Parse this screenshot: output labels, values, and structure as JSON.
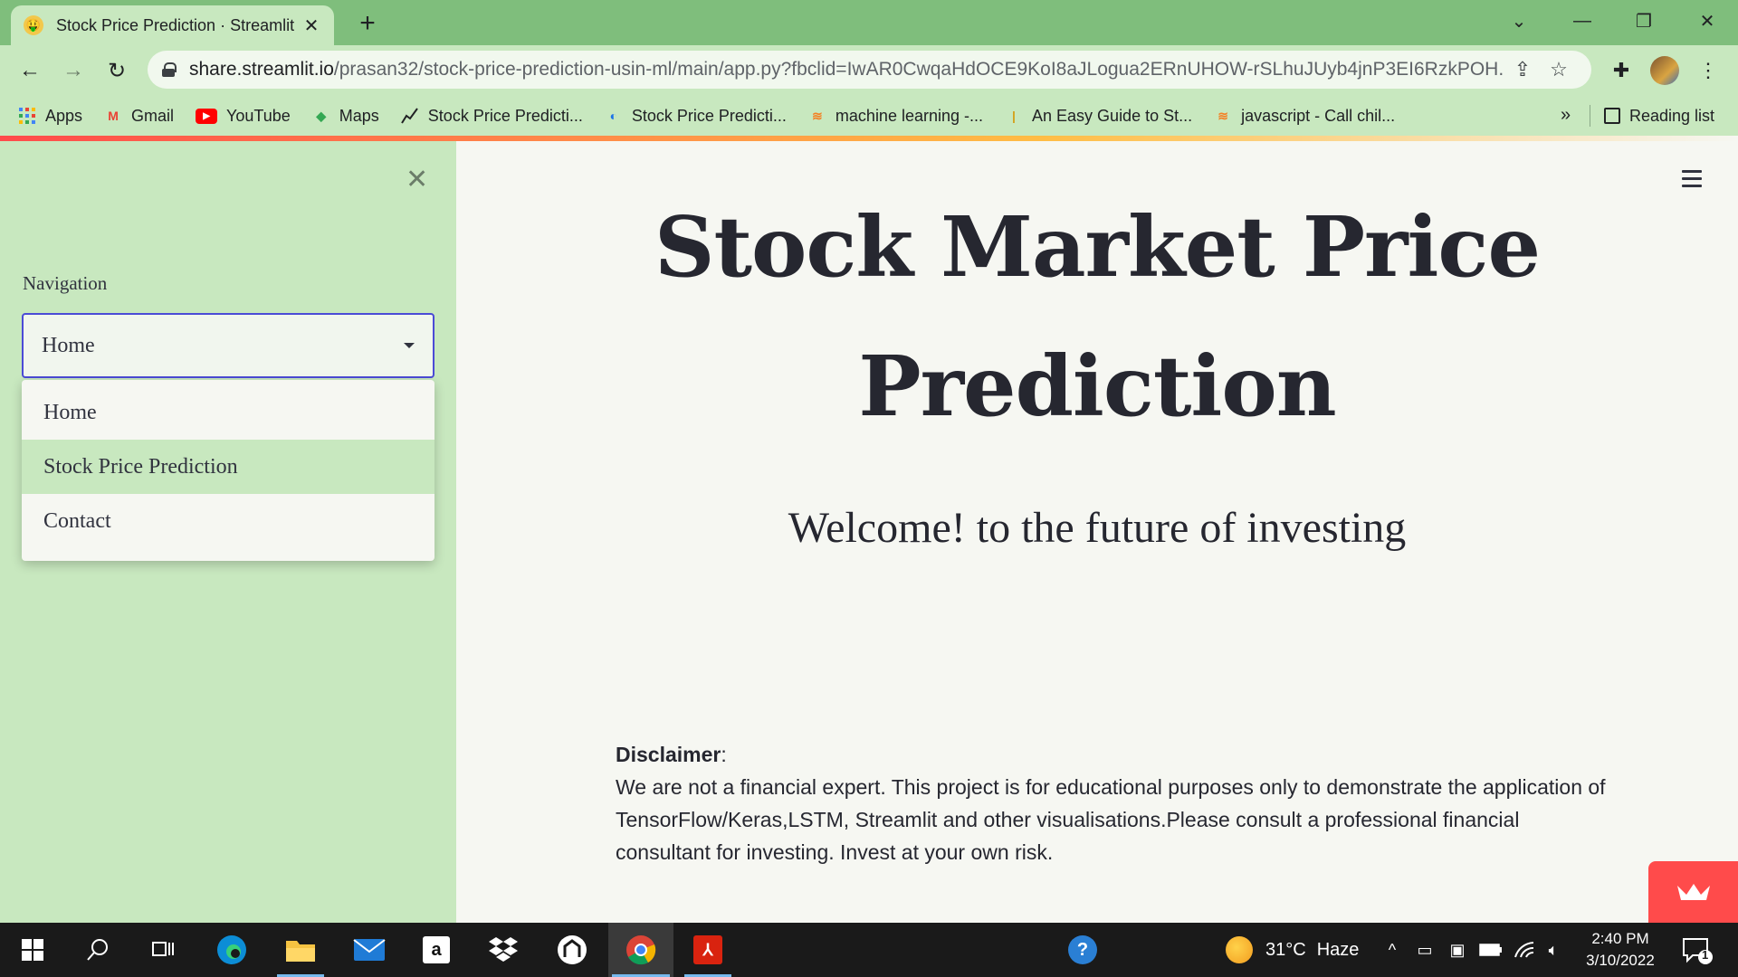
{
  "browser": {
    "tab_title": "Stock Price Prediction · Streamlit",
    "url_host": "share.streamlit.io",
    "url_path": "/prasan32/stock-price-prediction-usin-ml/main/app.py?fbclid=IwAR0CwqaHdOCE9KoI8aJLogua2ERnUHOW-rSLhuJUyb4jnP3EI6RzkPOH...",
    "bookmarks": [
      {
        "label": "Apps",
        "icon": "apps-grid-icon"
      },
      {
        "label": "Gmail",
        "icon": "gmail-icon"
      },
      {
        "label": "YouTube",
        "icon": "youtube-icon"
      },
      {
        "label": "Maps",
        "icon": "maps-icon"
      },
      {
        "label": "Stock Price Predicti...",
        "icon": "chart-icon"
      },
      {
        "label": "Stock Price Predicti...",
        "icon": "site-icon"
      },
      {
        "label": "machine learning -...",
        "icon": "stackoverflow-icon"
      },
      {
        "label": "An Easy Guide to St...",
        "icon": "medium-icon"
      },
      {
        "label": "javascript - Call chil...",
        "icon": "stackoverflow-icon"
      }
    ],
    "more_bookmarks": "»",
    "reading_list": "Reading list"
  },
  "sidebar": {
    "nav_label": "Navigation",
    "selected": "Home",
    "options": [
      "Home",
      "Stock Price Prediction",
      "Contact"
    ]
  },
  "main": {
    "title_line1": "Stock Market Price",
    "title_line2": "Prediction",
    "welcome": "Welcome! to the future of investing",
    "disclaimer_label": "Disclaimer",
    "disclaimer_colon": ":",
    "disclaimer_text": "We are not a financial expert. This project is for educational purposes only to demonstrate the application of TensorFlow/Keras,LSTM, Streamlit and other visualisations.Please consult a professional financial consultant for investing. Invest at your own risk."
  },
  "taskbar": {
    "weather_temp": "31°C",
    "weather_desc": "Haze",
    "time": "2:40 PM",
    "date": "3/10/2022",
    "notification_count": "1"
  },
  "colors": {
    "sidebar_bg": "#c8e8bf",
    "main_bg": "#f6f7f2",
    "select_border": "#4b4bd6",
    "streamlit_red": "#ff4b4b"
  }
}
